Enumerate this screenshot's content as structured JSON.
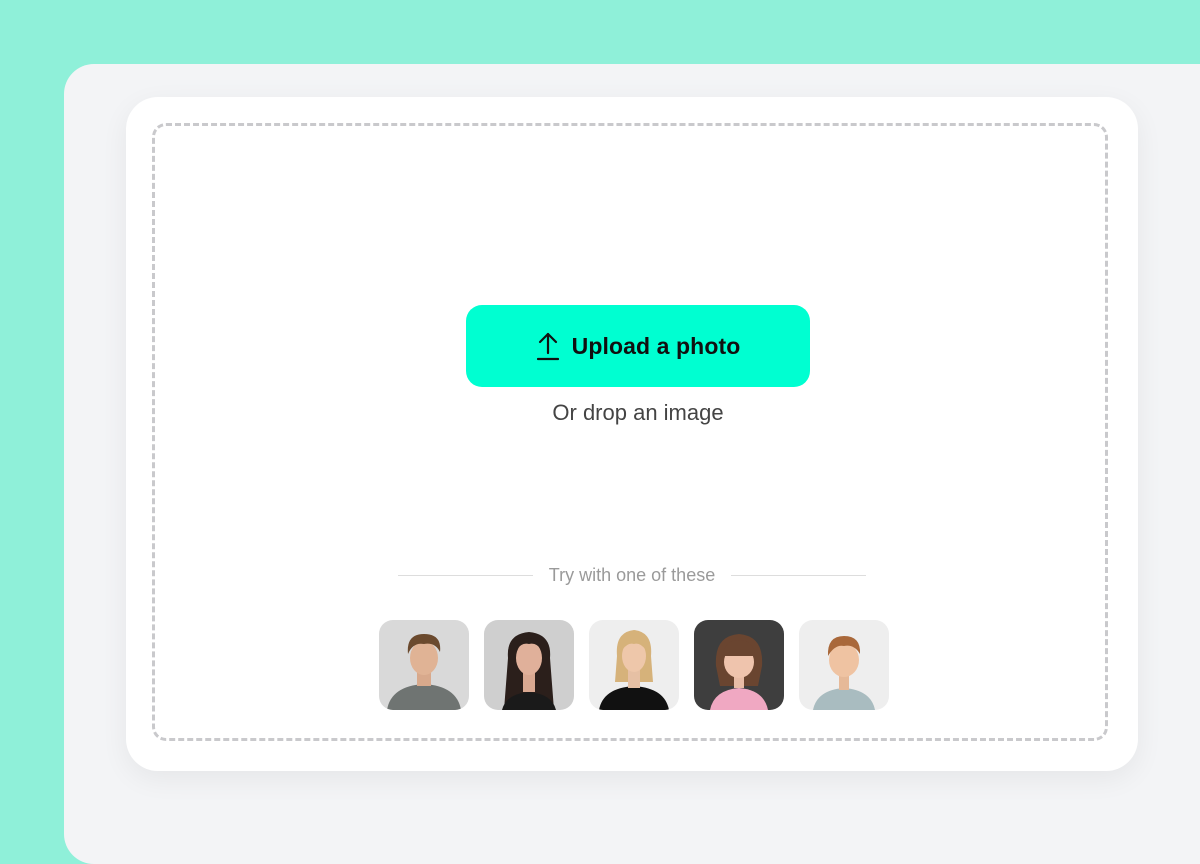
{
  "upload": {
    "button_label": "Upload a photo",
    "icon": "upload-arrow-icon",
    "drop_hint": "Or drop an image"
  },
  "samples": {
    "label": "Try with one of these",
    "items": [
      {
        "name": "young man with curly hair in grey sweater"
      },
      {
        "name": "young woman with long dark hair"
      },
      {
        "name": "young woman with blonde hair in black t-shirt"
      },
      {
        "name": "little girl with bangs in pink dress"
      },
      {
        "name": "little boy in light blue shirt"
      }
    ]
  },
  "colors": {
    "page_background": "#8ff0d9",
    "panel_background": "#f3f4f6",
    "accent": "#00ffd1"
  }
}
